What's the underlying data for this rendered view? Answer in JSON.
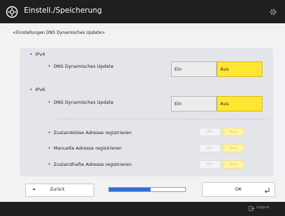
{
  "header": {
    "title": "Einstell./Speicherung"
  },
  "breadcrumb": "<Einstellungen DNS Dynamisches Update>",
  "ipv4": {
    "section_label": "IPv4",
    "rows": [
      {
        "label": "DNS Dynamisches Update",
        "on_label": "Ein",
        "off_label": "Aus",
        "selected": "Aus"
      }
    ]
  },
  "ipv6": {
    "section_label": "IPv6",
    "rows": [
      {
        "label": "DNS Dynamisches Update",
        "on_label": "Ein",
        "off_label": "Aus",
        "selected": "Aus"
      },
      {
        "label": "Zustandslose Adresse registrieren",
        "on_label": "Ein",
        "off_label": "Aus",
        "selected": "Aus",
        "enabled": false
      },
      {
        "label": "Manuelle Adresse registrieren",
        "on_label": "Ein",
        "off_label": "Aus",
        "selected": "Aus",
        "enabled": false
      },
      {
        "label": "Zustandhafte Adresse registrieren",
        "on_label": "Ein",
        "off_label": "Aus",
        "selected": "Aus",
        "enabled": false
      }
    ]
  },
  "footer": {
    "back_label": "Zurück",
    "ok_label": "OK",
    "logout_label": "Logout",
    "progress": 0.55
  },
  "colors": {
    "selected": "#ffe632",
    "accent": "#2f6fd6",
    "titlebar": "#1f1f1f"
  },
  "icons": {
    "title": "settings-save-icon",
    "settings": "gear-icon",
    "back": "back-arrow-icon",
    "ok": "return-icon",
    "logout": "logout-icon"
  }
}
